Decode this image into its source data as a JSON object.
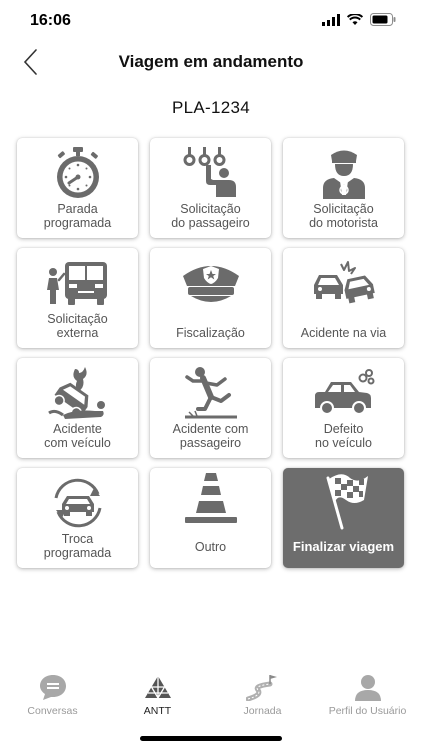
{
  "status": {
    "time": "16:06"
  },
  "header": {
    "title": "Viagem em andamento"
  },
  "vehicle": {
    "plate": "PLA-1234"
  },
  "tiles": [
    {
      "label": "Parada\nprogramada",
      "icon": "stopwatch-icon"
    },
    {
      "label": "Solicitação\ndo passageiro",
      "icon": "bus-passenger-icon"
    },
    {
      "label": "Solicitação\ndo motorista",
      "icon": "driver-icon"
    },
    {
      "label": "Solicitação\nexterna",
      "icon": "bus-external-icon"
    },
    {
      "label": "Fiscalização",
      "icon": "police-cap-icon"
    },
    {
      "label": "Acidente na via",
      "icon": "car-crash-icon"
    },
    {
      "label": "Acidente\ncom veículo",
      "icon": "vehicle-accident-icon"
    },
    {
      "label": "Acidente com\npassageiro",
      "icon": "passenger-fall-icon"
    },
    {
      "label": "Defeito\nno veículo",
      "icon": "broken-car-icon"
    },
    {
      "label": "Troca\nprogramada",
      "icon": "car-swap-icon"
    },
    {
      "label": "Outro",
      "icon": "traffic-cone-icon"
    },
    {
      "label": "Finalizar viagem",
      "icon": "checkered-flag-icon"
    }
  ],
  "tabs": [
    {
      "label": "Conversas",
      "icon": "chat-icon"
    },
    {
      "label": "ANTT",
      "icon": "antt-logo-icon"
    },
    {
      "label": "Jornada",
      "icon": "road-flag-icon"
    },
    {
      "label": "Perfil do Usuário",
      "icon": "user-icon"
    }
  ],
  "colors": {
    "icon_gray": "#6b6b6b",
    "finish_tile_bg": "#6d6d6d"
  }
}
